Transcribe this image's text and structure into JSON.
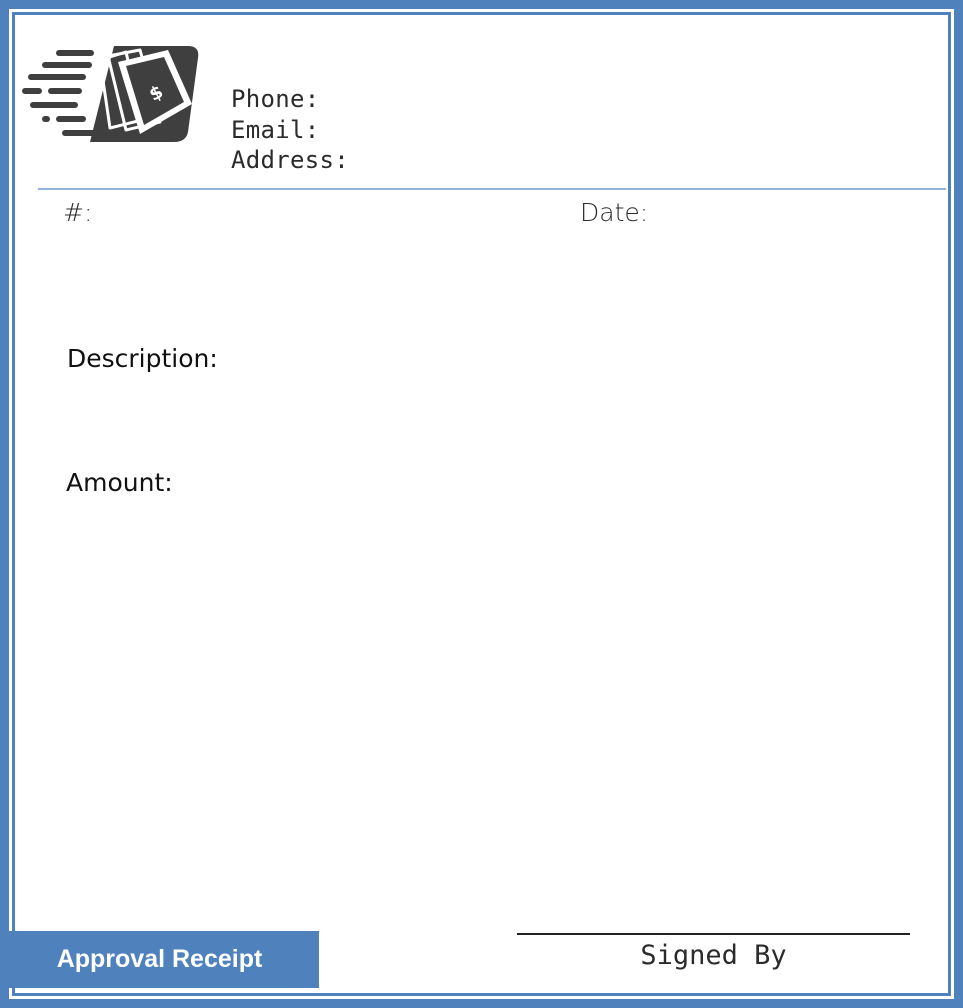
{
  "header": {
    "logo_icon": "flying-money-icon",
    "contact": {
      "phone_label": "Phone:",
      "email_label": "Email:",
      "address_label": "Address:"
    }
  },
  "fields": {
    "number_label": "#:",
    "date_label": "Date:",
    "description_label": "Description:",
    "amount_label": "Amount:"
  },
  "footer": {
    "signature_caption": "Signed By",
    "banner_label": "Approval Receipt"
  },
  "colors": {
    "frame": "#4f81bd",
    "divider": "#95b3d7",
    "banner": "#4f81bd",
    "logo": "#3f3f3f"
  }
}
